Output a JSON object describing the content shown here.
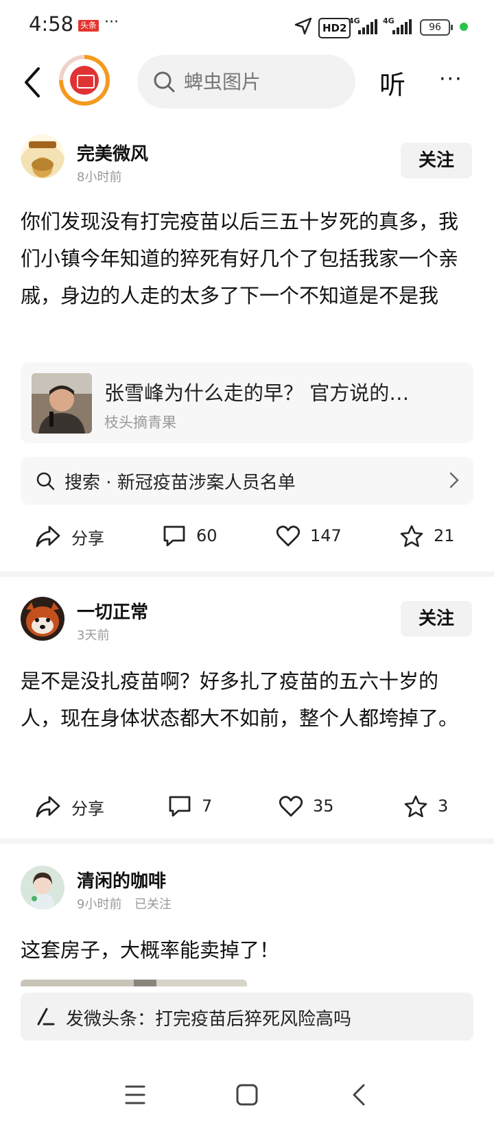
{
  "status_bar": {
    "time": "4:58",
    "news_badge": "头条",
    "dots": "···",
    "hd": "HD2",
    "sig1": "4G",
    "sig2": "4G",
    "battery": "96"
  },
  "nav": {
    "search_placeholder": "蜱虫图片",
    "listen_label": "听",
    "more_label": "···"
  },
  "posts": [
    {
      "username": "完美微风",
      "time": "8小时前",
      "follow_label": "关注",
      "body": "你们发现没有打完疫苗以后三五十岁死的真多，我们小镇今年知道的猝死有好几个了包括我家一个亲戚，身边的人走的太多了下一个不知道是不是我",
      "card": {
        "title": "张雪峰为什么走的早？ 官方说的…",
        "source": "枝头摘青果"
      },
      "related_search": "搜索 · 新冠疫苗涉案人员名单",
      "actions": {
        "share": "分享",
        "comments": "60",
        "likes": "147",
        "favorites": "21"
      }
    },
    {
      "username": "一切正常",
      "time": "3天前",
      "follow_label": "关注",
      "body": "是不是没扎疫苗啊？好多扎了疫苗的五六十岁的人，现在身体状态都大不如前，整个人都垮掉了。",
      "actions": {
        "share": "分享",
        "comments": "7",
        "likes": "35",
        "favorites": "3"
      }
    },
    {
      "username": "清闲的咖啡",
      "time": "9小时前",
      "followed": "已关注",
      "body": "这套房子，大概率能卖掉了！"
    }
  ],
  "compose_bar": {
    "text": "发微头条：打完疫苗后猝死风险高吗"
  }
}
